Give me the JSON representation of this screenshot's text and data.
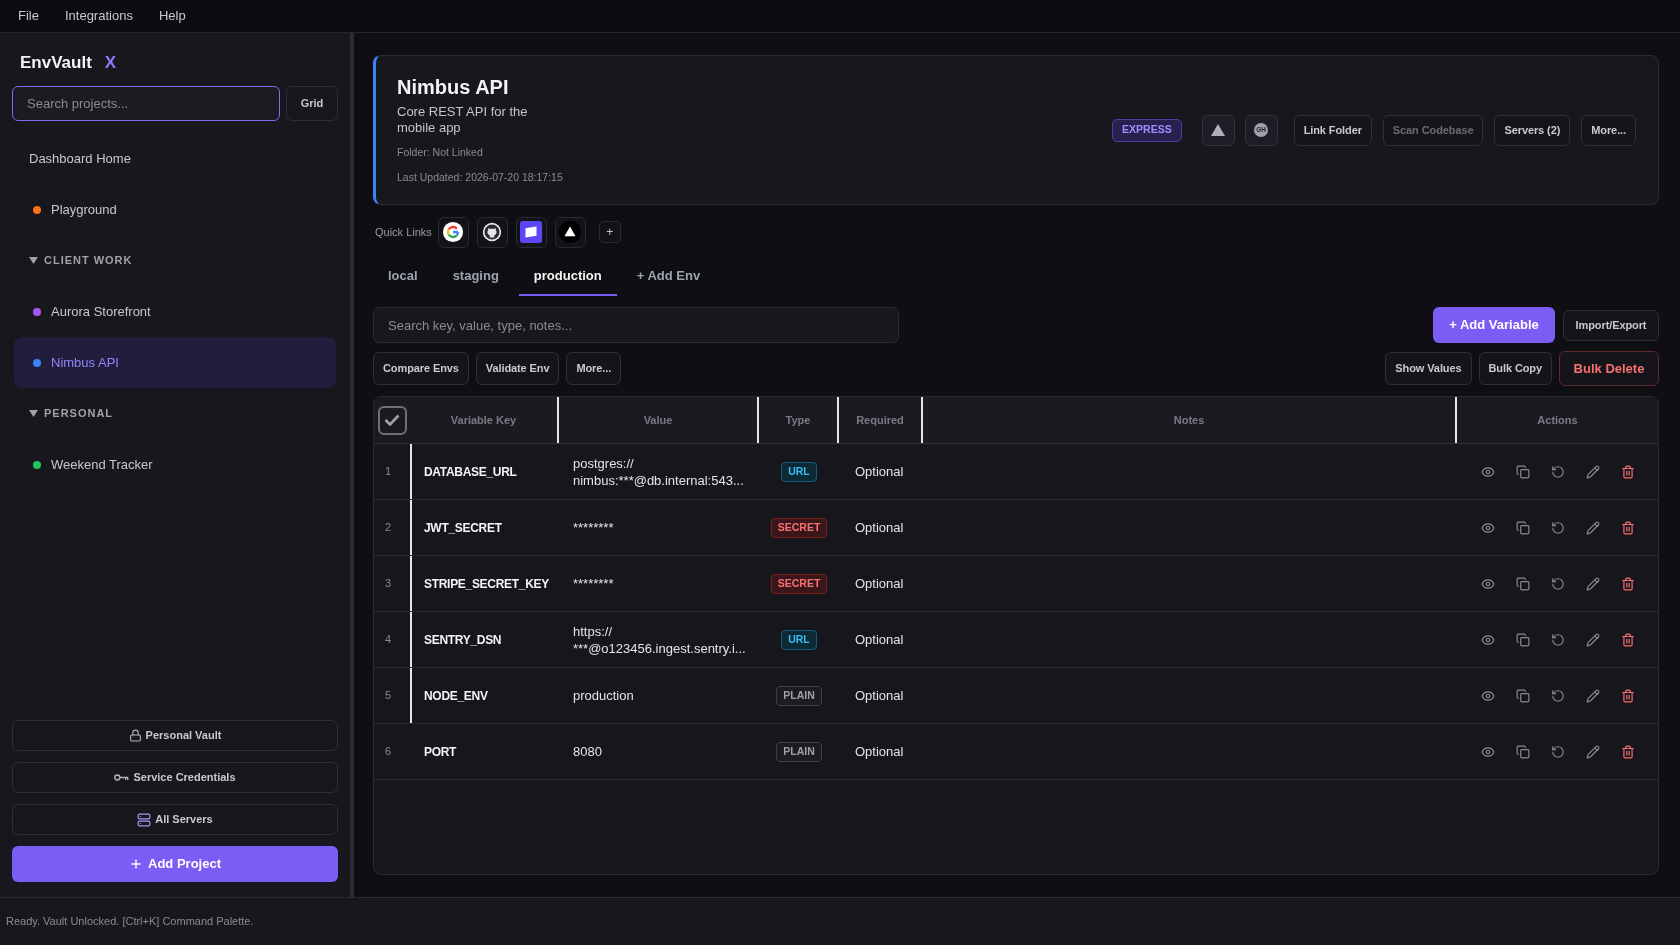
{
  "menu": [
    "File",
    "Integrations",
    "Help"
  ],
  "sidebar": {
    "brand": {
      "name": "EnvVault",
      "mark": "X"
    },
    "search": {
      "placeholder": "Search projects..."
    },
    "view_toggle": "Grid",
    "items": [
      {
        "kind": "link",
        "label": "Dashboard Home",
        "selected": false
      },
      {
        "kind": "project",
        "label": "Playground",
        "color": "#f97316",
        "selected": false
      },
      {
        "kind": "group",
        "label": "CLIENT WORK",
        "expanded": true,
        "children": [
          {
            "kind": "project",
            "label": "Aurora Storefront",
            "color": "#a855f7",
            "selected": false
          },
          {
            "kind": "project",
            "label": "Nimbus API",
            "color": "#3b82f6",
            "selected": true
          }
        ]
      },
      {
        "kind": "group",
        "label": "PERSONAL",
        "expanded": true,
        "children": [
          {
            "kind": "project",
            "label": "Weekend Tracker",
            "color": "#22c55e",
            "selected": false
          }
        ]
      }
    ],
    "footer_buttons": [
      {
        "label": "Personal Vault"
      },
      {
        "label": "Service Credentials"
      },
      {
        "label": "All Servers"
      }
    ],
    "add_project": "Add Project"
  },
  "project": {
    "name": "Nimbus API",
    "description": "Core REST API for the mobile app",
    "folder": "Folder: Not Linked",
    "last_updated": "Last Updated: 2026-07-20 18:17:15",
    "framework": "EXPRESS",
    "repo_label": "GH",
    "actions": [
      {
        "label": "Link Folder",
        "disabled": false
      },
      {
        "label": "Scan Codebase",
        "disabled": true
      },
      {
        "label": "Servers (2)",
        "disabled": false
      },
      {
        "label": "More...",
        "disabled": false
      }
    ]
  },
  "quick_links": {
    "label": "Quick Links",
    "add": "+"
  },
  "env_tabs": [
    {
      "label": "local",
      "selected": false
    },
    {
      "label": "staging",
      "selected": false
    },
    {
      "label": "production",
      "selected": true
    }
  ],
  "add_env": "+ Add Env",
  "toolbar": {
    "search": {
      "placeholder": "Search key, value, type, notes..."
    },
    "add_variable": "+ Add Variable",
    "import_export": "Import/Export",
    "left_buttons": [
      {
        "label": "Compare Envs"
      },
      {
        "label": "Validate Env"
      },
      {
        "label": "More..."
      }
    ],
    "right_buttons": [
      {
        "label": "Show Values",
        "kind": "default"
      },
      {
        "label": "Bulk Copy",
        "kind": "default"
      },
      {
        "label": "Bulk Delete",
        "kind": "danger"
      }
    ]
  },
  "table": {
    "select_all": {
      "checked": true
    },
    "columns": [
      "Variable Key",
      "Value",
      "Type",
      "Required",
      "Notes",
      "Actions"
    ],
    "rows": [
      {
        "number": "1",
        "key": "DATABASE_URL",
        "value": "postgres://\nnimbus:***@db.internal:543...",
        "type": {
          "label": "URL",
          "kind": "url"
        },
        "required": "Optional"
      },
      {
        "number": "2",
        "key": "JWT_SECRET",
        "value": "********",
        "type": {
          "label": "SECRET",
          "kind": "secret"
        },
        "required": "Optional"
      },
      {
        "number": "3",
        "key": "STRIPE_SECRET_KEY",
        "value": "********",
        "type": {
          "label": "SECRET",
          "kind": "secret"
        },
        "required": "Optional"
      },
      {
        "number": "4",
        "key": "SENTRY_DSN",
        "value": "https://\n***@o123456.ingest.sentry.i...",
        "type": {
          "label": "URL",
          "kind": "url"
        },
        "required": "Optional"
      },
      {
        "number": "5",
        "key": "NODE_ENV",
        "value": "production",
        "type": {
          "label": "PLAIN",
          "kind": "plain"
        },
        "required": "Optional"
      },
      {
        "number": "6",
        "key": "PORT",
        "value": "8080",
        "type": {
          "label": "PLAIN",
          "kind": "plain"
        },
        "required": "Optional"
      }
    ]
  },
  "status_bar": "Ready. Vault Unlocked. [Ctrl+K] Command Palette."
}
